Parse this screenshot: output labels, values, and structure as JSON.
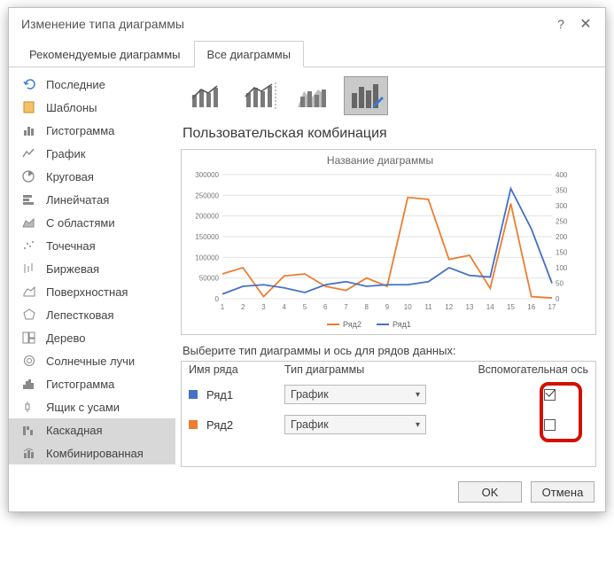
{
  "window": {
    "title": "Изменение типа диаграммы",
    "help": "?",
    "close": "✕"
  },
  "tabs": {
    "recommended": "Рекомендуемые диаграммы",
    "all": "Все диаграммы"
  },
  "sidebar": {
    "items": [
      {
        "label": "Последние"
      },
      {
        "label": "Шаблоны"
      },
      {
        "label": "Гистограмма"
      },
      {
        "label": "График"
      },
      {
        "label": "Круговая"
      },
      {
        "label": "Линейчатая"
      },
      {
        "label": "С областями"
      },
      {
        "label": "Точечная"
      },
      {
        "label": "Биржевая"
      },
      {
        "label": "Поверхностная"
      },
      {
        "label": "Лепестковая"
      },
      {
        "label": "Дерево"
      },
      {
        "label": "Солнечные лучи"
      },
      {
        "label": "Гистограмма"
      },
      {
        "label": "Ящик с усами"
      },
      {
        "label": "Каскадная"
      },
      {
        "label": "Комбинированная"
      }
    ]
  },
  "main": {
    "section_title": "Пользовательская комбинация",
    "series_table": {
      "instruction": "Выберите тип диаграммы и ось для рядов данных:",
      "col_name": "Имя ряда",
      "col_type": "Тип диаграммы",
      "col_aux": "Вспомогательная ось",
      "type_label": "График",
      "rows": [
        {
          "name": "Ряд1",
          "checked": true
        },
        {
          "name": "Ряд2",
          "checked": false
        }
      ]
    }
  },
  "buttons": {
    "ok": "OK",
    "cancel": "Отмена"
  },
  "legend": {
    "s2": "Ряд2",
    "s1": "Ряд1"
  },
  "chart_data": {
    "type": "line",
    "title": "Название диаграммы",
    "xlabel": "",
    "ylabel": "",
    "x": [
      1,
      2,
      3,
      4,
      5,
      6,
      7,
      8,
      9,
      10,
      11,
      12,
      13,
      14,
      15,
      16,
      17
    ],
    "left_axis": {
      "min": 0,
      "max": 300000,
      "step": 50000
    },
    "right_axis": {
      "min": 0,
      "max": 400,
      "step": 50
    },
    "colors": {
      "Ряд1": "#4472C4",
      "Ряд2": "#ED7D31"
    },
    "series": [
      {
        "name": "Ряд2",
        "axis": "left",
        "values": [
          60000,
          75000,
          5000,
          55000,
          60000,
          30000,
          20000,
          50000,
          30000,
          245000,
          240000,
          95000,
          105000,
          25000,
          230000,
          5000,
          2000
        ]
      },
      {
        "name": "Ряд1",
        "axis": "right",
        "values": [
          15,
          40,
          45,
          35,
          20,
          45,
          55,
          40,
          45,
          45,
          55,
          100,
          75,
          70,
          355,
          225,
          50
        ]
      }
    ]
  }
}
